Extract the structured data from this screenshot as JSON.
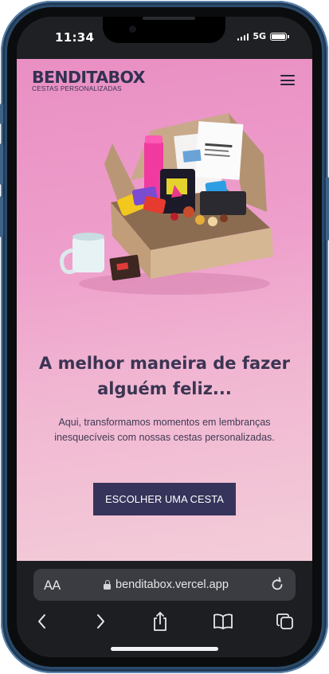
{
  "status_bar": {
    "time": "11:34",
    "network": "5G",
    "icons": [
      "signal-icon",
      "battery-icon"
    ]
  },
  "site": {
    "logo_main": "BENDITABOX",
    "logo_sub": "CESTAS PERSONALIZADAS",
    "menu_icon": "hamburger-menu-icon"
  },
  "hero": {
    "image_subject": "gift-box-icon",
    "title": "A melhor maneira de fazer alguém feliz...",
    "subtitle": "Aqui, transformamos momentos em lembranças inesquecíveis com nossas cestas personalizadas.",
    "cta_label": "ESCOLHER UMA CESTA"
  },
  "browser": {
    "text_size_label": "AA",
    "url": "benditabox.vercel.app",
    "toolbar_icons": [
      "back-icon",
      "forward-icon",
      "share-icon",
      "bookmarks-icon",
      "tabs-icon",
      "reload-icon"
    ]
  },
  "colors": {
    "brand_dark": "#36345b",
    "page_pink": "#ee9fcb",
    "text_dark": "#3a3553"
  }
}
